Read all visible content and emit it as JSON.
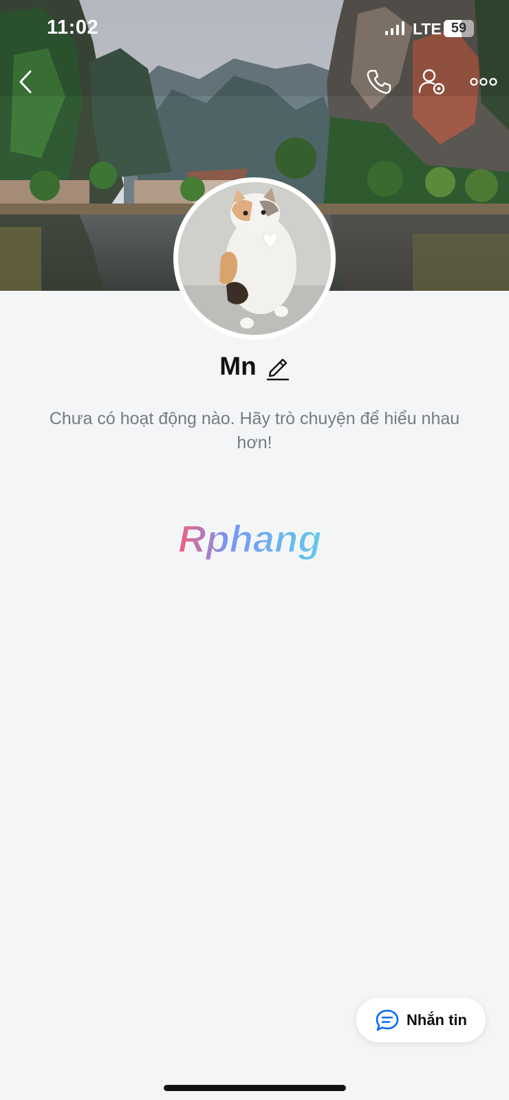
{
  "status_bar": {
    "time": "11:02",
    "network": "LTE",
    "battery": "59",
    "battery_level": 0.59
  },
  "nav": {
    "icons": [
      "chevron-left-icon",
      "phone-icon",
      "user-settings-icon",
      "more-dots-icon"
    ]
  },
  "profile": {
    "name": "Mn",
    "empty_activity": "Chưa có hoạt động nào. Hãy trò chuyện để hiểu nhau hơn!"
  },
  "watermark": {
    "text": "Rphang"
  },
  "actions": {
    "message_label": "Nhắn tin"
  },
  "colors": {
    "background": "#f4f5f7",
    "accent": "#0068ff",
    "text_primary": "#111111",
    "text_secondary": "#767a80"
  }
}
